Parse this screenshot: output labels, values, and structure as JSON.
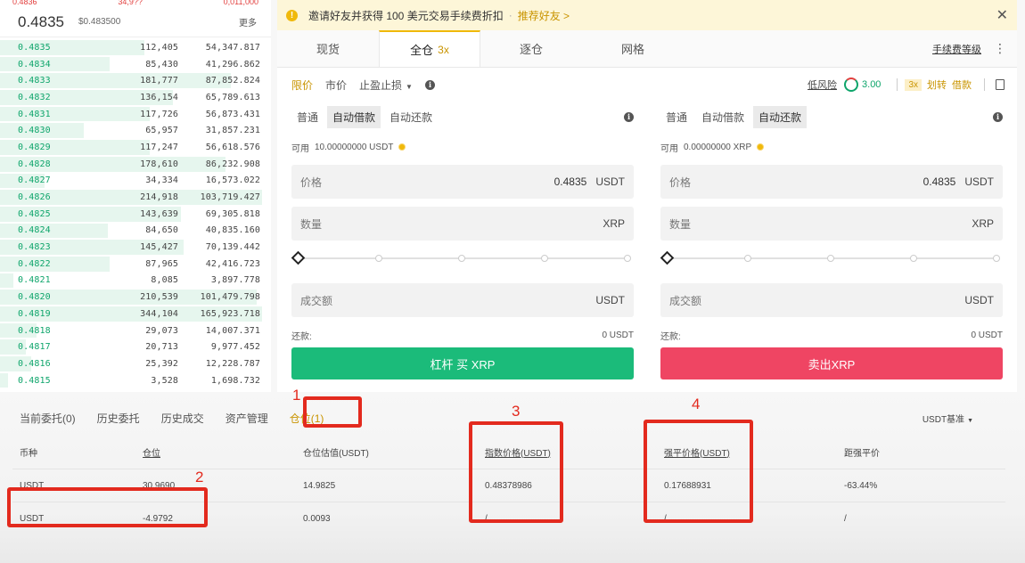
{
  "orderbook": {
    "top_sliver": [
      "0.4836",
      "34,9??",
      "0,011,000"
    ],
    "last_price": "0.4835",
    "usd_price": "$0.483500",
    "more_label": "更多",
    "rows": [
      {
        "price": "0.4835",
        "amount": "112,405",
        "total": "54,347.817",
        "depth": 0.55
      },
      {
        "price": "0.4834",
        "amount": "85,430",
        "total": "41,296.862",
        "depth": 0.42
      },
      {
        "price": "0.4833",
        "amount": "181,777",
        "total": "87,852.824",
        "depth": 0.88
      },
      {
        "price": "0.4832",
        "amount": "136,154",
        "total": "65,789.613",
        "depth": 0.66
      },
      {
        "price": "0.4831",
        "amount": "117,726",
        "total": "56,873.431",
        "depth": 0.57
      },
      {
        "price": "0.4830",
        "amount": "65,957",
        "total": "31,857.231",
        "depth": 0.32
      },
      {
        "price": "0.4829",
        "amount": "117,247",
        "total": "56,618.576",
        "depth": 0.57
      },
      {
        "price": "0.4828",
        "amount": "178,610",
        "total": "86,232.908",
        "depth": 0.86
      },
      {
        "price": "0.4827",
        "amount": "34,334",
        "total": "16,573.022",
        "depth": 0.17
      },
      {
        "price": "0.4826",
        "amount": "214,918",
        "total": "103,719.427",
        "depth": 1.0
      },
      {
        "price": "0.4825",
        "amount": "143,639",
        "total": "69,305.818",
        "depth": 0.69
      },
      {
        "price": "0.4824",
        "amount": "84,650",
        "total": "40,835.160",
        "depth": 0.41
      },
      {
        "price": "0.4823",
        "amount": "145,427",
        "total": "70,139.442",
        "depth": 0.7
      },
      {
        "price": "0.4822",
        "amount": "87,965",
        "total": "42,416.723",
        "depth": 0.42
      },
      {
        "price": "0.4821",
        "amount": "8,085",
        "total": "3,897.778",
        "depth": 0.05
      },
      {
        "price": "0.4820",
        "amount": "210,539",
        "total": "101,479.798",
        "depth": 0.98
      },
      {
        "price": "0.4819",
        "amount": "344,104",
        "total": "165,923.718",
        "depth": 1.0
      },
      {
        "price": "0.4818",
        "amount": "29,073",
        "total": "14,007.371",
        "depth": 0.14
      },
      {
        "price": "0.4817",
        "amount": "20,713",
        "total": "9,977.452",
        "depth": 0.1
      },
      {
        "price": "0.4816",
        "amount": "25,392",
        "total": "12,228.787",
        "depth": 0.12
      },
      {
        "price": "0.4815",
        "amount": "3,528",
        "total": "1,698.732",
        "depth": 0.03
      }
    ]
  },
  "banner": {
    "icon": "!",
    "text": "邀请好友并获得 100 美元交易手续费折扣",
    "separator": "·",
    "link": "推荐好友 >",
    "close": "✕"
  },
  "mode_tabs": {
    "spot": "现货",
    "cross": "全仓",
    "cross_leverage": "3x",
    "isolated": "逐仓",
    "grid": "网格",
    "fee_level": "手续费等级",
    "more": "⋮"
  },
  "order_types": {
    "limit": "限价",
    "market": "市价",
    "stop": "止盈止损",
    "caret": "▼",
    "info": "i",
    "risk_label": "低风险",
    "risk_value": "3.00",
    "leverage_badge": "3x",
    "transfer": "划转",
    "borrow": "借款"
  },
  "buy": {
    "modes": [
      "普通",
      "自动借款",
      "自动还款"
    ],
    "active_mode": 1,
    "available_label": "可用",
    "available_value": "10.00000000 USDT",
    "price_label": "价格",
    "price_value": "0.4835",
    "price_unit": "USDT",
    "amount_label": "数量",
    "amount_unit": "XRP",
    "total_label": "成交额",
    "total_unit": "USDT",
    "repay_label": "还款:",
    "repay_value": "0 USDT",
    "button": "杠杆 买 XRP"
  },
  "sell": {
    "modes": [
      "普通",
      "自动借款",
      "自动还款"
    ],
    "active_mode": 2,
    "available_label": "可用",
    "available_value": "0.00000000 XRP",
    "price_label": "价格",
    "price_value": "0.4835",
    "price_unit": "USDT",
    "amount_label": "数量",
    "amount_unit": "XRP",
    "total_label": "成交额",
    "total_unit": "USDT",
    "repay_label": "还款:",
    "repay_value": "0 USDT",
    "button": "卖出XRP"
  },
  "bottom_tabs": {
    "items": [
      "当前委托(0)",
      "历史委托",
      "历史成交",
      "资产管理",
      "仓位(1)"
    ],
    "active": 4,
    "base_select": "USDT基准",
    "caret": "▼"
  },
  "positions": {
    "headers": [
      "币种",
      "仓位",
      "仓位估值(USDT)",
      "指数价格(USDT)",
      "强平价格(USDT)",
      "距强平价"
    ],
    "rows": [
      [
        "USDT",
        "30.9690",
        "14.9825",
        "0.48378986",
        "0.17688931",
        "-63.44%"
      ],
      [
        "USDT",
        "-4.9792",
        "0.0093",
        "/",
        "/",
        "/"
      ]
    ]
  },
  "annotations": [
    "1",
    "2",
    "3",
    "4"
  ],
  "colors": {
    "accent": "#f0b90b",
    "buy": "#1bbb7a",
    "sell": "#ef4563",
    "bid_price": "#0ea56b",
    "annotation": "#e32a1e"
  }
}
